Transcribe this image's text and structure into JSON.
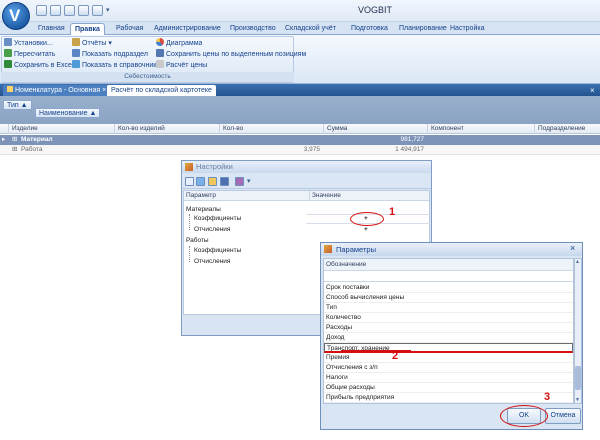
{
  "window": {
    "title": "VOGBIT"
  },
  "ribbon": {
    "tabs": [
      "Главная",
      "Правка",
      "Рабочая",
      "Администрирование",
      "Производство",
      "Складской учёт",
      "Подготовка",
      "Планирование",
      "Настройка"
    ],
    "active_tab": "Правка",
    "buttons": {
      "settings": "Установки...",
      "recalculate": "Пересчитать",
      "save_excel": "Сохранить в Excel",
      "reports": "Отчёты",
      "show_departments": "Показать подраздел",
      "show_in_directory": "Показать в справочнике",
      "diagram": "Диаграмма",
      "save_prices": "Сохранить цены по выделенным позициям",
      "price_calc": "Расчёт цены"
    },
    "group_caption": "Себестоимость"
  },
  "doc_tabs": [
    "Номенклатура - Основная",
    "Расчёт по складской картотеке"
  ],
  "grouping": {
    "chip_type": "Тип",
    "chip_name": "Наименование"
  },
  "grid": {
    "columns": [
      "Изделие",
      "Кол-во изделий",
      "Кол-во",
      "Сумма",
      "Компонент",
      "Подразделение"
    ],
    "rows": [
      {
        "name": "Материал",
        "qty": "",
        "sum": "981,727"
      },
      {
        "name": "Работа",
        "qty": "3,975",
        "sum": "1 494,917"
      }
    ]
  },
  "settings_dialog": {
    "title": "Настройки",
    "columns": [
      "Параметр",
      "Значение"
    ],
    "groups": [
      {
        "label": "Материалы",
        "items": [
          {
            "label": "Коэффициенты",
            "value": "+"
          },
          {
            "label": "Отчисления",
            "value": "+"
          }
        ]
      },
      {
        "label": "Работы",
        "items": [
          {
            "label": "Коэффициенты",
            "value": ""
          },
          {
            "label": "Отчисления",
            "value": ""
          }
        ]
      }
    ]
  },
  "params_dialog": {
    "title": "Параметры",
    "header": "Обозначение",
    "items": [
      "Срок поставки",
      "Способ вычисления цены",
      "Тип",
      "Количество",
      "Расходы",
      "Доход",
      "Транспорт, хранение",
      "Премия",
      "Отчисления с з/п",
      "Налоги",
      "Общие расходы",
      "Прибыль предприятия"
    ],
    "selected": "Транспорт, хранение",
    "ok": "OK",
    "cancel": "Отмена"
  },
  "callouts": [
    "1",
    "2",
    "3"
  ],
  "colors": {
    "accent": "#15428b",
    "selection": "#7d93b8",
    "annotation": "#d40f0f"
  }
}
